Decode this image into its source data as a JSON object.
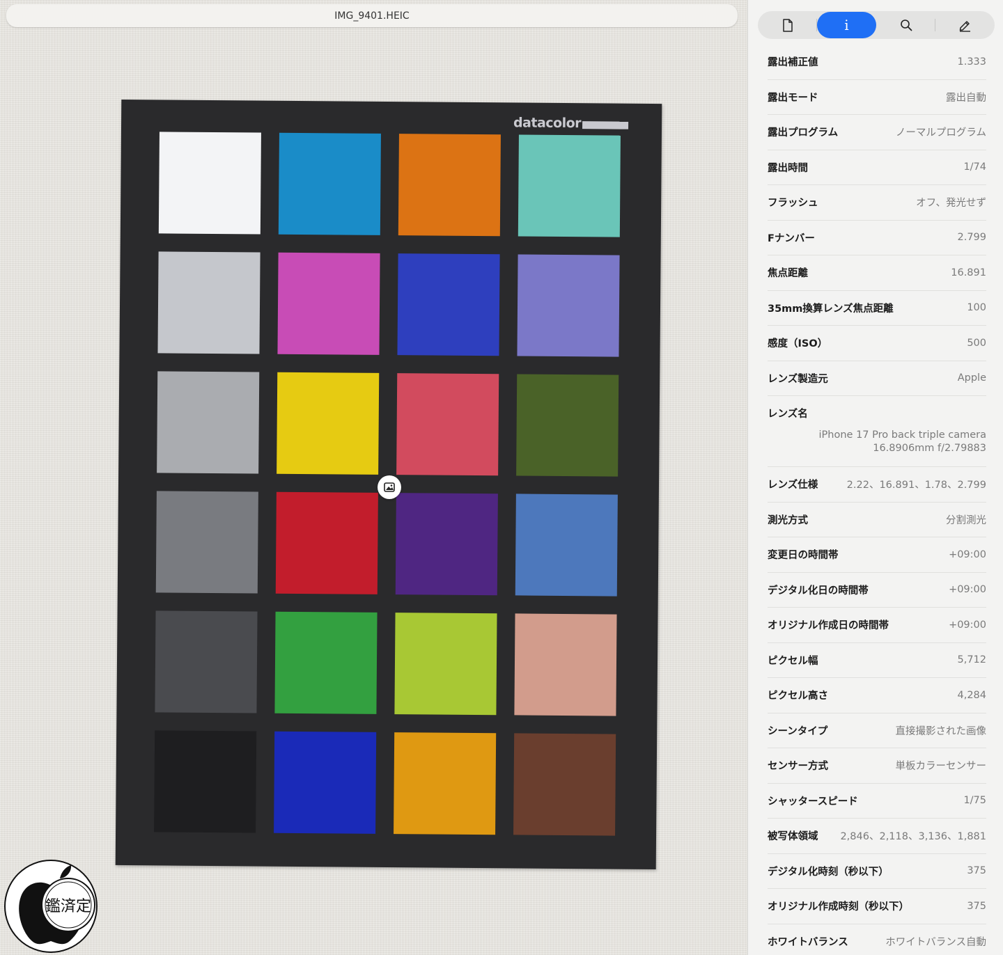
{
  "viewer": {
    "filename": "IMG_9401.HEIC",
    "brand_text": "datacolor",
    "patches": [
      "#f3f4f6",
      "#1a8cc8",
      "#dc7314",
      "#6ac5b8",
      "#c5c7cc",
      "#c84cb6",
      "#2e3fbe",
      "#7b78c8",
      "#aaacb0",
      "#e6cb12",
      "#d24b5e",
      "#4a6228",
      "#797b80",
      "#c21d2c",
      "#4f2682",
      "#4d78bc",
      "#4a4b4f",
      "#33a040",
      "#a8c834",
      "#d29c8c",
      "#1e1e20",
      "#1a2ab8",
      "#df9912",
      "#6a3e2e"
    ]
  },
  "watermark": {
    "text": "鑑済定"
  },
  "inspector": {
    "tabs": [
      {
        "name": "tab-document",
        "icon": "document-icon",
        "active": false
      },
      {
        "name": "tab-info",
        "icon": "info-icon",
        "label": "i",
        "active": true
      },
      {
        "name": "tab-search",
        "icon": "search-icon",
        "active": false
      },
      {
        "name": "tab-markup",
        "icon": "pencil-icon",
        "active": false
      }
    ],
    "rows": [
      {
        "label": "露出補正値",
        "value": "1.333"
      },
      {
        "label": "露出モード",
        "value": "露出自動"
      },
      {
        "label": "露出プログラム",
        "value": "ノーマルプログラム"
      },
      {
        "label": "露出時間",
        "value": "1/74"
      },
      {
        "label": "フラッシュ",
        "value": "オフ、発光せず"
      },
      {
        "label": "Fナンバー",
        "value": "2.799"
      },
      {
        "label": "焦点距離",
        "value": "16.891"
      },
      {
        "label": "35mm換算レンズ焦点距離",
        "value": "100"
      },
      {
        "label": "感度（ISO）",
        "value": "500"
      },
      {
        "label": "レンズ製造元",
        "value": "Apple"
      },
      {
        "label": "レンズ名",
        "value": "iPhone 17 Pro back triple camera 16.8906mm f/2.79883",
        "tall": true
      },
      {
        "label": "レンズ仕様",
        "value": "2.22、16.891、1.78、2.799"
      },
      {
        "label": "測光方式",
        "value": "分割測光"
      },
      {
        "label": "変更日の時間帯",
        "value": "+09:00"
      },
      {
        "label": "デジタル化日の時間帯",
        "value": "+09:00"
      },
      {
        "label": "オリジナル作成日の時間帯",
        "value": "+09:00"
      },
      {
        "label": "ピクセル幅",
        "value": "5,712"
      },
      {
        "label": "ピクセル高さ",
        "value": "4,284"
      },
      {
        "label": "シーンタイプ",
        "value": "直接撮影された画像"
      },
      {
        "label": "センサー方式",
        "value": "単板カラーセンサー"
      },
      {
        "label": "シャッタースピード",
        "value": "1/75"
      },
      {
        "label": "被写体領域",
        "value": "2,846、2,118、3,136、1,881"
      },
      {
        "label": "デジタル化時刻（秒以下）",
        "value": "375"
      },
      {
        "label": "オリジナル作成時刻（秒以下）",
        "value": "375"
      },
      {
        "label": "ホワイトバランス",
        "value": "ホワイトバランス自動"
      }
    ]
  }
}
